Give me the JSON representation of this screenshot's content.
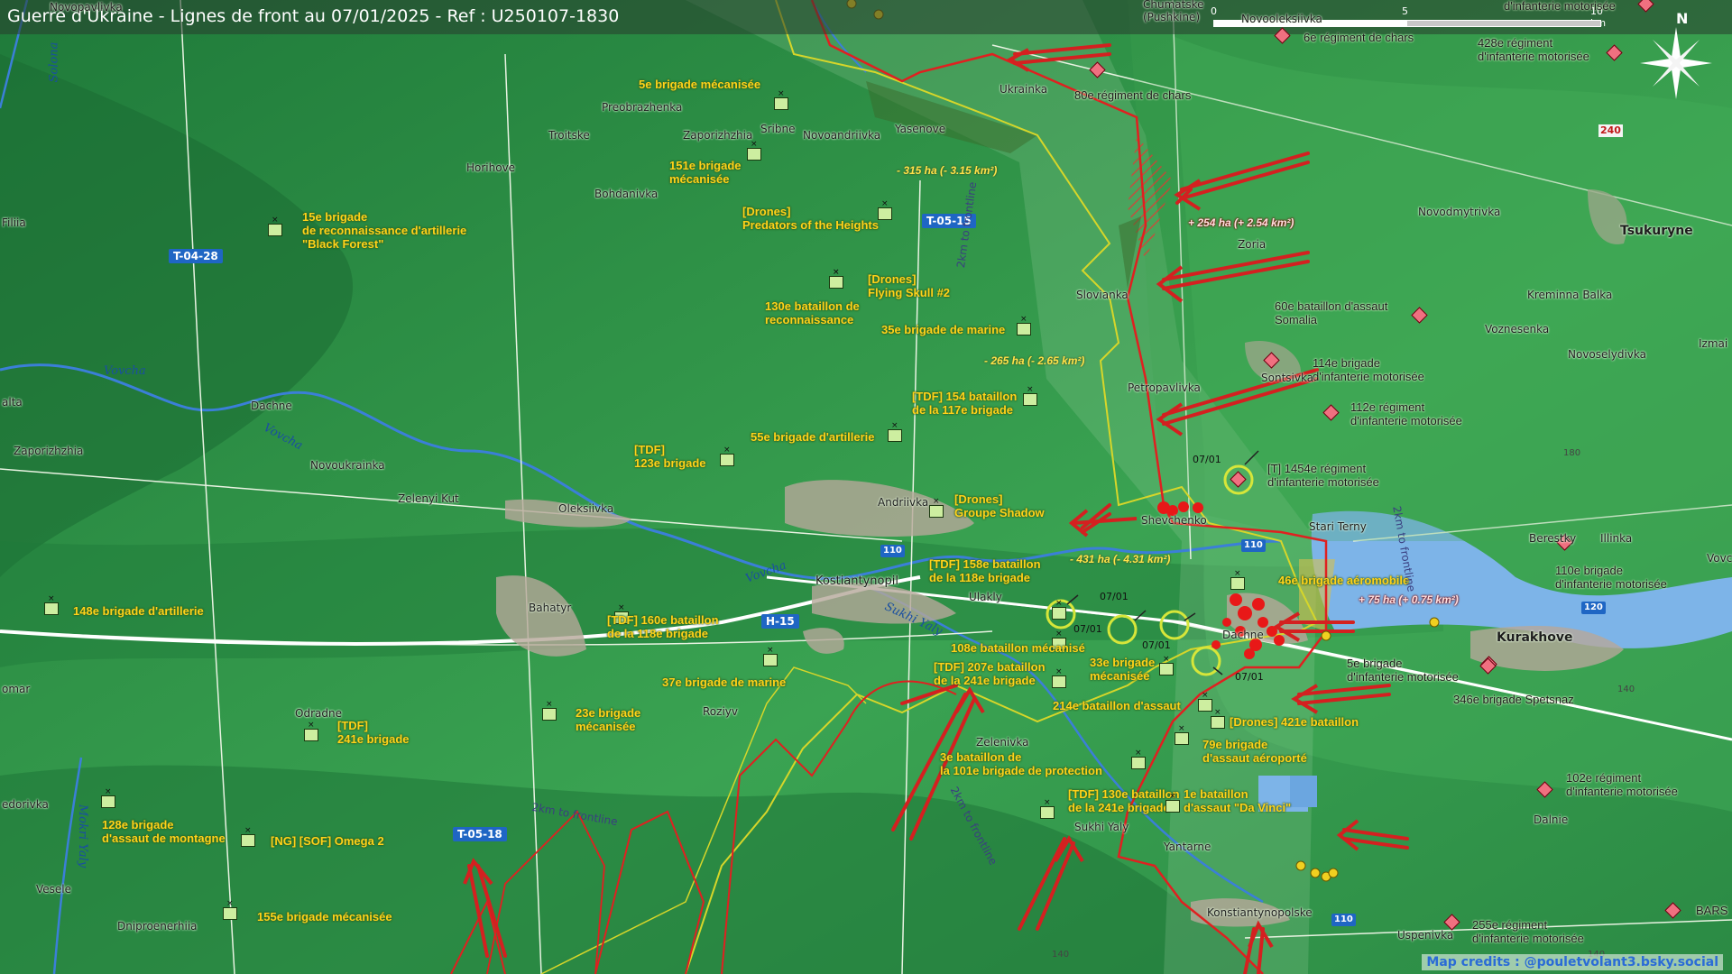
{
  "title": "Guerre d'Ukraine - Lignes de front au 07/01/2025 - Ref : U250107-1830",
  "credits": "Map credits : @pouletvolant3.bsky.social",
  "scale": {
    "t0": "0",
    "t5": "5",
    "t10": "10 km"
  },
  "north": "N",
  "colors": {
    "terrain": "#2f8f45",
    "ukr_line": "#d6d62a",
    "rus_line": "#e02020",
    "arrow": "#d42020",
    "water": "#7db4e8",
    "ukr_unit": "#cdeea0",
    "rus_unit": "#f07080"
  },
  "ukr_units": [
    {
      "id": "u1",
      "label": "5e brigade mécanisée"
    },
    {
      "id": "u2",
      "label": "151e brigade\nmécanisée"
    },
    {
      "id": "u3",
      "label": "15e brigade\nde reconnaissance d'artillerie\n\"Black Forest\""
    },
    {
      "id": "u4",
      "label": "[Drones]\nPredators of the Heights"
    },
    {
      "id": "u5",
      "label": "[Drones]\nFlying Skull #2"
    },
    {
      "id": "u6",
      "label": "130e bataillon de\nreconnaissance"
    },
    {
      "id": "u7",
      "label": "35e brigade de marine"
    },
    {
      "id": "u8",
      "label": "[TDF] 154 bataillon\nde la 117e brigade"
    },
    {
      "id": "u9",
      "label": "55e brigade d'artillerie"
    },
    {
      "id": "u10",
      "label": "[TDF]\n123e brigade"
    },
    {
      "id": "u11",
      "label": "[Drones]\nGroupe Shadow"
    },
    {
      "id": "u12",
      "label": "[TDF] 158e bataillon\nde la 118e brigade"
    },
    {
      "id": "u13",
      "label": "46e brigade aéromobile"
    },
    {
      "id": "u14",
      "label": "148e brigade d'artillerie"
    },
    {
      "id": "u15",
      "label": "[TDF] 160e bataillon\nde la 118e brigade"
    },
    {
      "id": "u16",
      "label": "108e bataillon mécanisé"
    },
    {
      "id": "u17",
      "label": "33e brigade\nmécanisée"
    },
    {
      "id": "u18",
      "label": "37e brigade de marine"
    },
    {
      "id": "u19",
      "label": "[TDF] 207e bataillon\nde la 241e brigade"
    },
    {
      "id": "u20",
      "label": "214e bataillon d'assaut"
    },
    {
      "id": "u21",
      "label": "[Drones] 421e bataillon"
    },
    {
      "id": "u22",
      "label": "23e brigade\nmécanisée"
    },
    {
      "id": "u23",
      "label": "[TDF]\n241e brigade"
    },
    {
      "id": "u24",
      "label": "79e brigade\nd'assaut aéroporté"
    },
    {
      "id": "u25",
      "label": "3e bataillon de\nla 101e brigade de protection"
    },
    {
      "id": "u26",
      "label": "128e brigade\nd'assaut de montagne"
    },
    {
      "id": "u27",
      "label": "[NG] [SOF] Omega 2"
    },
    {
      "id": "u28",
      "label": "[TDF] 130e bataillon\nde la 241e brigade"
    },
    {
      "id": "u29",
      "label": "1e bataillon\nd'assaut \"Da Vinci\""
    },
    {
      "id": "u30",
      "label": "155e brigade mécanisée"
    }
  ],
  "rus_units": [
    {
      "id": "r1",
      "label": "6e régiment de chars"
    },
    {
      "id": "r2",
      "label": "80e régiment de chars"
    },
    {
      "id": "r3",
      "label": "428e régiment\nd'infanterie motorisée"
    },
    {
      "id": "r4",
      "label": "d'infanterie motorisée"
    },
    {
      "id": "r5",
      "label": "60e bataillon d'assaut\nSomalia"
    },
    {
      "id": "r6",
      "label": "114e brigade\nd'infanterie motorisée"
    },
    {
      "id": "r7",
      "label": "112e régiment\nd'infanterie motorisée"
    },
    {
      "id": "r8",
      "label": "[T] 1454e régiment\nd'infanterie motorisée"
    },
    {
      "id": "r9",
      "label": "110e brigade\nd'infanterie motorisée"
    },
    {
      "id": "r10",
      "label": "5e brigade\nd'infanterie motorisée"
    },
    {
      "id": "r11",
      "label": "346e brigade Spetsnaz"
    },
    {
      "id": "r12",
      "label": "102e régiment\nd'infanterie motorisée"
    },
    {
      "id": "r13",
      "label": "255e régiment\nd'infanterie motorisée"
    },
    {
      "id": "r14",
      "label": "BARS"
    }
  ],
  "places": {
    "novopavlivka": "Novopavlivka",
    "preobrazhenka": "Preobrazhenka",
    "troitske": "Troitske",
    "zaporizhzhia_n": "Zaporizhzhia",
    "sribne": "Sribne",
    "novoandriivka": "Novoandriivka",
    "yasenove": "Yasenove",
    "ukrainka": "Ukrainka",
    "horihove": "Horihove",
    "bohdanivka": "Bohdanivka",
    "filiia": "Filiia",
    "chumatske": "Chumatske\n(Pushkine)",
    "novooleksiivka": "Novooleksiivka",
    "zoria": "Zoria",
    "novodmytrivka": "Novodmytrivka",
    "tsukuryne": "Tsukuryne",
    "slovianka": "Slovianka",
    "kreminna_balka": "Kreminna Balka",
    "voznesenka": "Voznesenka",
    "izmailivka": "Izmai",
    "sontsivka": "Sontsivka",
    "novoselydivka": "Novoselydivka",
    "petropavlivka": "Petropavlivka",
    "dachne_w": "Dachne",
    "zaporizhzhia_w": "Zaporizhzhia",
    "novoukrainka": "Novoukrainka",
    "zelenyi_kut": "Zelenyi Kut",
    "oleksiivka": "Oleksiivka",
    "andriivka": "Andriivka",
    "shevchenko": "Shevchenko",
    "stari_terny": "Stari Terny",
    "berestky": "Berestky",
    "illinka": "Illinka",
    "vovcha_e": "Vovch",
    "kostiantynopil": "Kostiantynopil",
    "ulakly": "Ulakly",
    "dachne": "Dachne",
    "kurakhove": "Kurakhove",
    "bahatyr": "Bahatyr",
    "odradne": "Odradne",
    "roziyv": "Roziyv",
    "zelenivka": "Zelenivka",
    "sukhi_yaly_town": "Sukhi Yaly",
    "yantarne": "Yantarne",
    "dalnie": "Dalnie",
    "konstiantynopolske": "Konstiantynopolske",
    "uspenivka": "Uspenivka",
    "vedorivka": "edorivka",
    "veseie": "Vesele",
    "dniproenerhiia": "Dniproenerhiia",
    "malta": "alta",
    "komar": "omar"
  },
  "rivers": {
    "vovcha_1": "Vovcha",
    "vovcha_2": "Vovcha",
    "vovcha_3": "Vovcha",
    "sukhi_yaly": "Sukhi Yaly",
    "mokri_yaly": "Mokri Yaly",
    "solona": "Solona"
  },
  "roads": {
    "t0428": "T-04-28",
    "t0515": "T-05-15",
    "h15": "H-15",
    "t0518": "T-05-18",
    "r110a": "110",
    "r110b": "110",
    "r110c": "110",
    "r120": "120",
    "r240": "240"
  },
  "frontline_labels": {
    "f1": "2km to frontline",
    "f2": "2km to frontline",
    "f3": "2km to frontline",
    "f4": "2km to frontline"
  },
  "areas": {
    "a1": "- 315 ha (- 3.15 km²)",
    "a2": "+ 254 ha (+ 2.54 km²)",
    "a3": "- 265 ha (- 2.65 km²)",
    "a4": "- 431 ha (- 4.31 km²)",
    "a5": "+ 75 ha (+ 0.75 km²)"
  },
  "dates": {
    "d1": "07/01",
    "d2": "07/01",
    "d3": "07/01",
    "d4": "07/01",
    "d5": "07/01"
  },
  "elev": {
    "e1": "180",
    "e2": "140",
    "e3": "140",
    "e4": "140"
  }
}
